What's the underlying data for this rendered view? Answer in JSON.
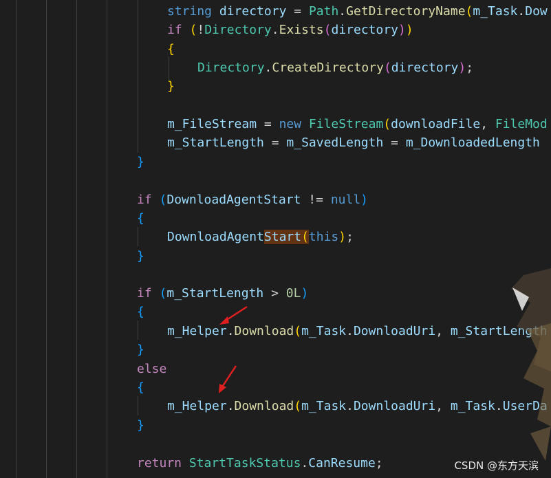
{
  "editor": {
    "lines": [
      {
        "indent": 4,
        "tokens": [
          [
            "string",
            "kw"
          ],
          [
            " "
          ],
          [
            "directory",
            "var"
          ],
          [
            " = "
          ],
          [
            "Path",
            "ty"
          ],
          [
            "."
          ],
          [
            "GetDirectoryName",
            "fn"
          ],
          [
            "(",
            "p1"
          ],
          [
            "m_Task",
            "var"
          ],
          [
            "."
          ],
          [
            "Dow",
            "var"
          ]
        ]
      },
      {
        "indent": 4,
        "tokens": [
          [
            "if",
            "ctl"
          ],
          [
            " "
          ],
          [
            "(",
            "p1"
          ],
          [
            "!"
          ],
          [
            "Directory",
            "ty"
          ],
          [
            "."
          ],
          [
            "Exists",
            "fn"
          ],
          [
            "(",
            "p2"
          ],
          [
            "directory",
            "var"
          ],
          [
            ")",
            "p2"
          ],
          [
            ")",
            "p1"
          ]
        ]
      },
      {
        "indent": 4,
        "tokens": [
          [
            "{",
            "p1"
          ]
        ]
      },
      {
        "indent": 5,
        "tokens": [
          [
            "Directory",
            "ty"
          ],
          [
            "."
          ],
          [
            "CreateDirectory",
            "fn"
          ],
          [
            "(",
            "p2"
          ],
          [
            "directory",
            "var"
          ],
          [
            ")",
            "p2"
          ],
          [
            ";"
          ]
        ]
      },
      {
        "indent": 4,
        "tokens": [
          [
            "}",
            "p1"
          ]
        ]
      },
      {
        "indent": 0,
        "tokens": []
      },
      {
        "indent": 4,
        "tokens": [
          [
            "m_FileStream",
            "var"
          ],
          [
            " = "
          ],
          [
            "new",
            "kw"
          ],
          [
            " "
          ],
          [
            "FileStream",
            "ty"
          ],
          [
            "(",
            "p1"
          ],
          [
            "downloadFile",
            "var"
          ],
          [
            ", "
          ],
          [
            "FileMod",
            "ty"
          ]
        ]
      },
      {
        "indent": 4,
        "tokens": [
          [
            "m_StartLength",
            "var"
          ],
          [
            " = "
          ],
          [
            "m_SavedLength",
            "var"
          ],
          [
            " = "
          ],
          [
            "m_DownloadedLength",
            "var"
          ]
        ]
      },
      {
        "indent": 3,
        "tokens": [
          [
            "}",
            "p3"
          ]
        ]
      },
      {
        "indent": 0,
        "tokens": []
      },
      {
        "indent": 3,
        "tokens": [
          [
            "if",
            "ctl"
          ],
          [
            " "
          ],
          [
            "(",
            "p3"
          ],
          [
            "DownloadAgentStart",
            "var"
          ],
          [
            " != "
          ],
          [
            "null",
            "kw"
          ],
          [
            ")",
            "p3"
          ]
        ]
      },
      {
        "indent": 3,
        "tokens": [
          [
            "{",
            "p3"
          ]
        ]
      },
      {
        "indent": 4,
        "tokens": [
          [
            "DownloadAgent",
            "var"
          ],
          [
            "Start",
            "var",
            "hl"
          ],
          [
            "(",
            "p1",
            "hl"
          ],
          [
            "this",
            "kw"
          ],
          [
            ")",
            "p1"
          ],
          [
            ";"
          ]
        ]
      },
      {
        "indent": 3,
        "tokens": [
          [
            "}",
            "p3"
          ]
        ]
      },
      {
        "indent": 0,
        "tokens": []
      },
      {
        "indent": 3,
        "tokens": [
          [
            "if",
            "ctl"
          ],
          [
            " "
          ],
          [
            "(",
            "p3"
          ],
          [
            "m_StartLength",
            "var"
          ],
          [
            " > "
          ],
          [
            "0L",
            "num"
          ],
          [
            ")",
            "p3"
          ]
        ]
      },
      {
        "indent": 3,
        "tokens": [
          [
            "{",
            "p3"
          ]
        ]
      },
      {
        "indent": 4,
        "tokens": [
          [
            "m_Helper",
            "var"
          ],
          [
            "."
          ],
          [
            "Download",
            "fn"
          ],
          [
            "(",
            "p1"
          ],
          [
            "m_Task",
            "var"
          ],
          [
            "."
          ],
          [
            "DownloadUri",
            "var"
          ],
          [
            ", "
          ],
          [
            "m_StartLength",
            "var"
          ]
        ]
      },
      {
        "indent": 3,
        "tokens": [
          [
            "}",
            "p3"
          ]
        ]
      },
      {
        "indent": 3,
        "tokens": [
          [
            "else",
            "ctl"
          ]
        ]
      },
      {
        "indent": 3,
        "tokens": [
          [
            "{",
            "p3"
          ]
        ]
      },
      {
        "indent": 4,
        "tokens": [
          [
            "m_Helper",
            "var"
          ],
          [
            "."
          ],
          [
            "Download",
            "fn"
          ],
          [
            "(",
            "p1"
          ],
          [
            "m_Task",
            "var"
          ],
          [
            "."
          ],
          [
            "DownloadUri",
            "var"
          ],
          [
            ", "
          ],
          [
            "m_Task",
            "var"
          ],
          [
            "."
          ],
          [
            "UserDa",
            "var"
          ]
        ]
      },
      {
        "indent": 3,
        "tokens": [
          [
            "}",
            "p3"
          ]
        ]
      },
      {
        "indent": 0,
        "tokens": []
      },
      {
        "indent": 3,
        "tokens": [
          [
            "return",
            "ctl"
          ],
          [
            " "
          ],
          [
            "StartTaskStatus",
            "ty"
          ],
          [
            "."
          ],
          [
            "CanResume",
            "var"
          ],
          [
            ";"
          ]
        ]
      }
    ]
  },
  "watermark": "CSDN @东方天滨",
  "colors": {
    "background": "#1e1e1e",
    "annotation_arrow": "#e02020"
  }
}
